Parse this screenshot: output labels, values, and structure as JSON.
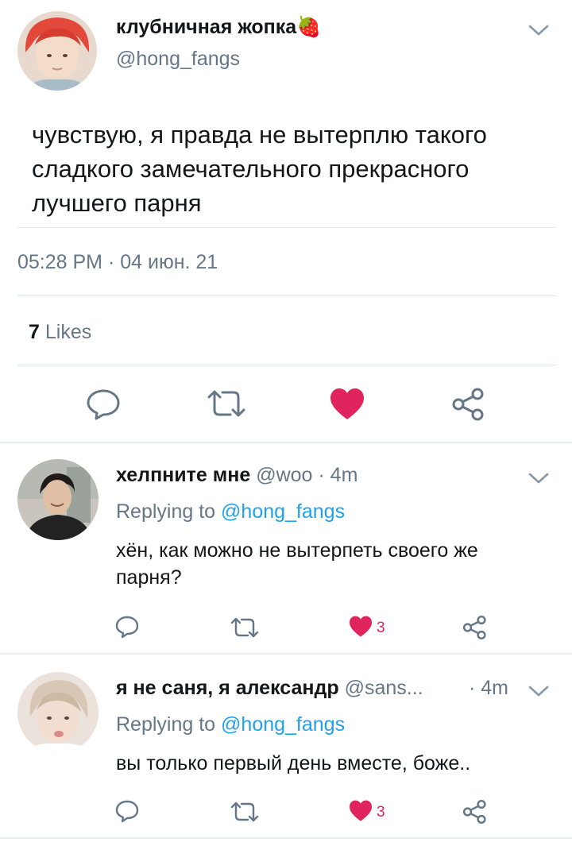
{
  "main_tweet": {
    "display_name": "клубничная жопка🍓",
    "handle": "@hong_fangs",
    "text": "чувствую, я правда не вытерплю такого сладкого замечательного прекрасного лучшего парня",
    "timestamp": "05:28 PM · 04 июн. 21",
    "likes_count": "7",
    "likes_label": "Likes",
    "liked": true
  },
  "replies": [
    {
      "display_name": "хелпните мне",
      "handle": "@woo",
      "time": "· 4m",
      "replying_prefix": "Replying to",
      "replying_to": "@hong_fangs",
      "text": "хён, как можно не вытерпеть своего же парня?",
      "like_count": "3",
      "liked": true
    },
    {
      "display_name": "я не саня, я александр",
      "handle": "@sans...",
      "time": "· 4m",
      "replying_prefix": "Replying to",
      "replying_to": "@hong_fangs",
      "text": "вы только первый день вместе, боже..",
      "like_count": "3",
      "liked": true
    }
  ],
  "icons": [
    "reply-icon",
    "retweet-icon",
    "heart-icon",
    "share-icon",
    "chevron-down-icon"
  ],
  "colors": {
    "text": "#14171a",
    "muted": "#657786",
    "link": "#1da1f2",
    "like": "#e0245e"
  }
}
